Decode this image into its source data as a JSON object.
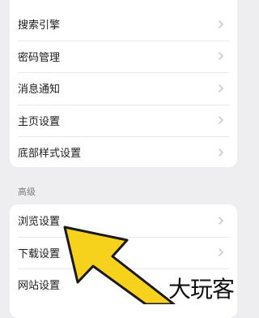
{
  "settings_top": {
    "items": [
      {
        "label": "搜索引擎"
      },
      {
        "label": "密码管理"
      },
      {
        "label": "消息通知"
      },
      {
        "label": "主页设置"
      },
      {
        "label": "底部样式设置"
      }
    ]
  },
  "advanced": {
    "title": "高级",
    "items": [
      {
        "label": "浏览设置"
      },
      {
        "label": "下载设置"
      },
      {
        "label": "网站设置"
      }
    ]
  },
  "overlay": {
    "arrow_color": "#f7d21c",
    "watermark_text": "大玩客"
  },
  "icons": {
    "chevron": "chevron-right-icon"
  }
}
